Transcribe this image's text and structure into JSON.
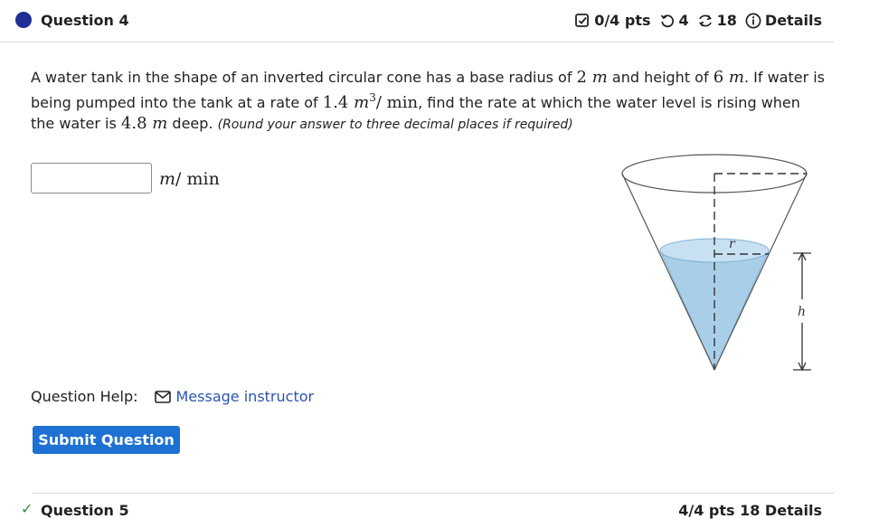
{
  "question": {
    "title": "Question 4",
    "points": "0/4 pts",
    "attempts": "4",
    "submissions": "18",
    "details_label": "Details"
  },
  "problem": {
    "t1": "A water tank in the shape of an inverted circular cone has a base radius of ",
    "radius_num": "2",
    "radius_unit": "m",
    "t2": " and height of ",
    "height_num": "6",
    "height_unit": "m",
    "t3": ". If water is being pumped into the tank at a rate of ",
    "rate_num": "1.4",
    "rate_unit": "m",
    "rate_exp": "3",
    "rate_per": "/ min",
    "t4": ", find the rate at which the water level is rising when the water is ",
    "depth_num": "4.8",
    "depth_unit": "m",
    "t5": " deep. ",
    "hint": "(Round your answer to three decimal places if required)"
  },
  "answer": {
    "value": "",
    "placeholder": "",
    "unit_var": "m",
    "unit_rest": "/ min"
  },
  "figure": {
    "r_label": "r",
    "h_label": "h"
  },
  "help": {
    "label": "Question Help:",
    "message_label": "Message instructor"
  },
  "submit_label": "Submit Question",
  "next_question": {
    "title": "Question 5",
    "meta": "4/4 pts  18  Details"
  },
  "colors": {
    "header_dot": "#1f2f97",
    "link": "#2a55b0",
    "submit_bg": "#1c71d3",
    "water": "#a9cfe8",
    "success": "#2e8b3d"
  },
  "icons": {
    "points": "checkbox-check-icon",
    "attempts": "retry-icon",
    "submissions": "refresh-icon",
    "details": "info-icon",
    "message": "envelope-icon"
  }
}
